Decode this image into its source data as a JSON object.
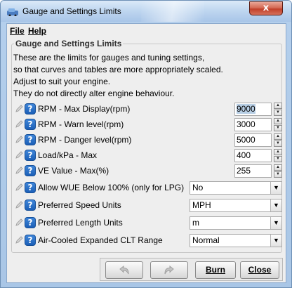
{
  "window": {
    "title": "Gauge and Settings Limits",
    "close_glyph": "x"
  },
  "menu": [
    {
      "label": "File"
    },
    {
      "label": "Help"
    }
  ],
  "group": {
    "title": "Gauge and Settings Limits",
    "description": [
      "These are the limits for gauges and tuning settings,",
      "so that curves and tables are more appropriately scaled.",
      "Adjust to suit your engine.",
      "They do not directly alter engine behaviour."
    ]
  },
  "fields": [
    {
      "label": "RPM - Max Display(rpm)",
      "value": "9000"
    },
    {
      "label": "RPM - Warn level(rpm)",
      "value": "3000"
    },
    {
      "label": "RPM - Danger level(rpm)",
      "value": "5000"
    },
    {
      "label": "Load/kPa - Max",
      "value": "400"
    },
    {
      "label": "VE Value - Max(%)",
      "value": "255"
    }
  ],
  "selects": [
    {
      "label": "Allow WUE Below 100% (only for LPG)",
      "value": "No"
    },
    {
      "label": "Preferred Speed Units",
      "value": "MPH"
    },
    {
      "label": "Preferred Length Units",
      "value": "m"
    },
    {
      "label": "Air-Cooled Expanded CLT Range",
      "value": "Normal"
    }
  ],
  "buttons": {
    "undo_icon": "undo-icon",
    "redo_icon": "redo-icon",
    "burn": "Burn",
    "close": "Close"
  },
  "help_glyph": "?",
  "colors": {
    "help_badge": "#1b5fb7",
    "close_button": "#c2412a",
    "selection": "#b8cfe5"
  }
}
